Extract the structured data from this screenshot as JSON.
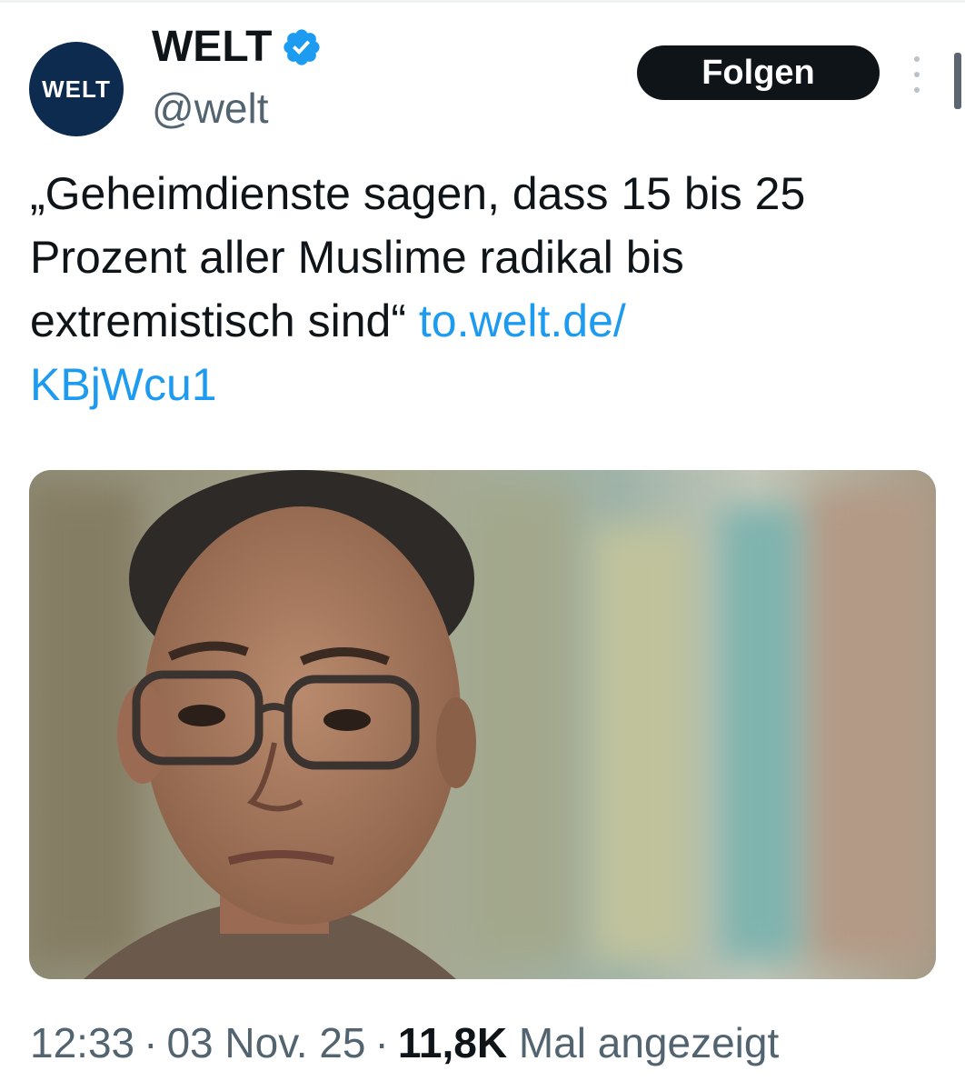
{
  "account": {
    "avatar_text": "WELT",
    "display_name": "WELT",
    "handle": "@welt",
    "verified": true,
    "avatar_color": "#0d2a4f",
    "verified_color": "#1d9bf0"
  },
  "actions": {
    "follow_label": "Folgen",
    "more_icon": "more-vertical-icon"
  },
  "tweet": {
    "text": "„Geheimdienste sagen, dass 15 bis 25 Prozent aller Muslime radikal bis extremistisch sind“",
    "link_part1": "to.welt.de/",
    "link_part2": "KBjWcu1",
    "link_color": "#1d9bf0"
  },
  "media": {
    "type": "photo"
  },
  "meta": {
    "time": "12:33",
    "date": "03 Nov. 25",
    "separator": "·",
    "views_count": "11,8K",
    "views_label": "Mal angezeigt"
  }
}
